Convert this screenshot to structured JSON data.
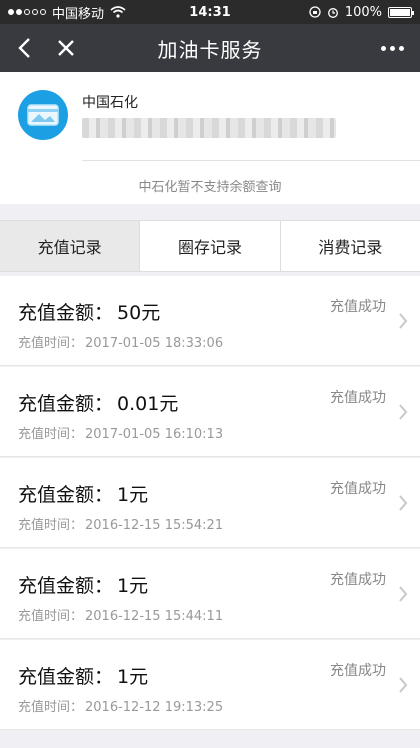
{
  "status_bar": {
    "carrier": "中国移动",
    "time": "14:31",
    "battery": "100%",
    "battery_level": 1.0
  },
  "nav": {
    "title": "加油卡服务"
  },
  "card": {
    "name": "中国石化",
    "note": "中石化暂不支持余额查询"
  },
  "tabs": [
    {
      "label": "充值记录",
      "active": true
    },
    {
      "label": "圈存记录",
      "active": false
    },
    {
      "label": "消费记录",
      "active": false
    }
  ],
  "records": [
    {
      "amount_label": "充值金额：",
      "amount": "50元",
      "time_label": "充值时间：",
      "time": "2017-01-05 18:33:06",
      "status": "充值成功"
    },
    {
      "amount_label": "充值金额：",
      "amount": "0.01元",
      "time_label": "充值时间：",
      "time": "2017-01-05 16:10:13",
      "status": "充值成功"
    },
    {
      "amount_label": "充值金额：",
      "amount": "1元",
      "time_label": "充值时间：",
      "time": "2016-12-15 15:54:21",
      "status": "充值成功"
    },
    {
      "amount_label": "充值金额：",
      "amount": "1元",
      "time_label": "充值时间：",
      "time": "2016-12-15 15:44:11",
      "status": "充值成功"
    },
    {
      "amount_label": "充值金额：",
      "amount": "1元",
      "time_label": "充值时间：",
      "time": "2016-12-12 19:13:25",
      "status": "充值成功"
    }
  ],
  "colors": {
    "nav_bg": "#393a3f",
    "status_bg": "#2b2b2b",
    "card_icon": "#1ca0e3",
    "page_bg": "#efeff4"
  },
  "icons": {
    "back": "chevron-left-icon",
    "close": "close-icon",
    "more": "more-icon",
    "card": "card-icon",
    "row": "chevron-right-icon"
  }
}
